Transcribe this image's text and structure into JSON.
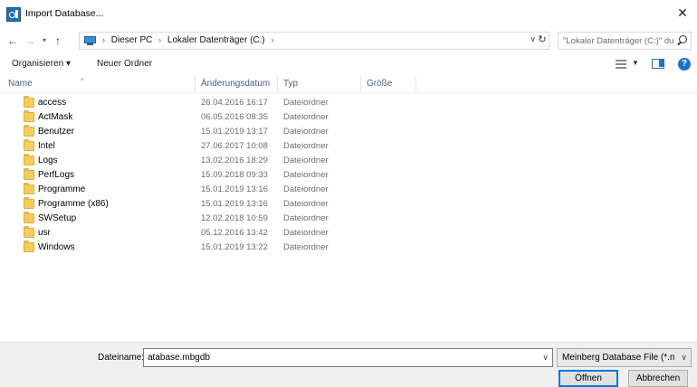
{
  "window": {
    "title": "Import Database..."
  },
  "nav": {
    "breadcrumb": [
      "Dieser PC",
      "Lokaler Datenträger (C:)"
    ],
    "search_placeholder": "\"Lokaler Datenträger (C:)\" dur..."
  },
  "toolbar": {
    "organize_label": "Organisieren ▾",
    "new_folder_label": "Neuer Ordner"
  },
  "columns": {
    "name": "Name",
    "date": "Änderungsdatum",
    "type": "Typ",
    "size": "Größe"
  },
  "files": [
    {
      "name": "access",
      "date": "26.04.2016 16:17",
      "type": "Dateiordner"
    },
    {
      "name": "ActMask",
      "date": "06.05.2016 08:35",
      "type": "Dateiordner"
    },
    {
      "name": "Benutzer",
      "date": "15.01.2019 13:17",
      "type": "Dateiordner"
    },
    {
      "name": "Intel",
      "date": "27.06.2017 10:08",
      "type": "Dateiordner"
    },
    {
      "name": "Logs",
      "date": "13.02.2016 18:29",
      "type": "Dateiordner"
    },
    {
      "name": "PerfLogs",
      "date": "15.09.2018 09:33",
      "type": "Dateiordner"
    },
    {
      "name": "Programme",
      "date": "15.01.2019 13:16",
      "type": "Dateiordner"
    },
    {
      "name": "Programme (x86)",
      "date": "15.01.2019 13:16",
      "type": "Dateiordner"
    },
    {
      "name": "SWSetup",
      "date": "12.02.2018 10:59",
      "type": "Dateiordner"
    },
    {
      "name": "usr",
      "date": "05.12.2016 13:42",
      "type": "Dateiordner"
    },
    {
      "name": "Windows",
      "date": "15.01.2019 13:22",
      "type": "Dateiordner"
    }
  ],
  "footer": {
    "filename_label": "Dateiname:",
    "filename_value": "atabase.mbgdb",
    "filetype_value": "Meinberg Database File (*.mbg",
    "open_label": "Öffnen",
    "cancel_label": "Abbrechen"
  },
  "colors": {
    "accent": "#0078d7",
    "folder": "#f6cd5a",
    "header_text": "#4c607a"
  },
  "icons": [
    "app-icon",
    "close-icon",
    "back-arrow-icon",
    "forward-arrow-icon",
    "recent-locations-icon",
    "up-arrow-icon",
    "pc-icon",
    "chevron-down-icon",
    "refresh-icon",
    "search-icon",
    "view-options-icon",
    "preview-pane-icon",
    "help-icon",
    "folder-icon"
  ]
}
